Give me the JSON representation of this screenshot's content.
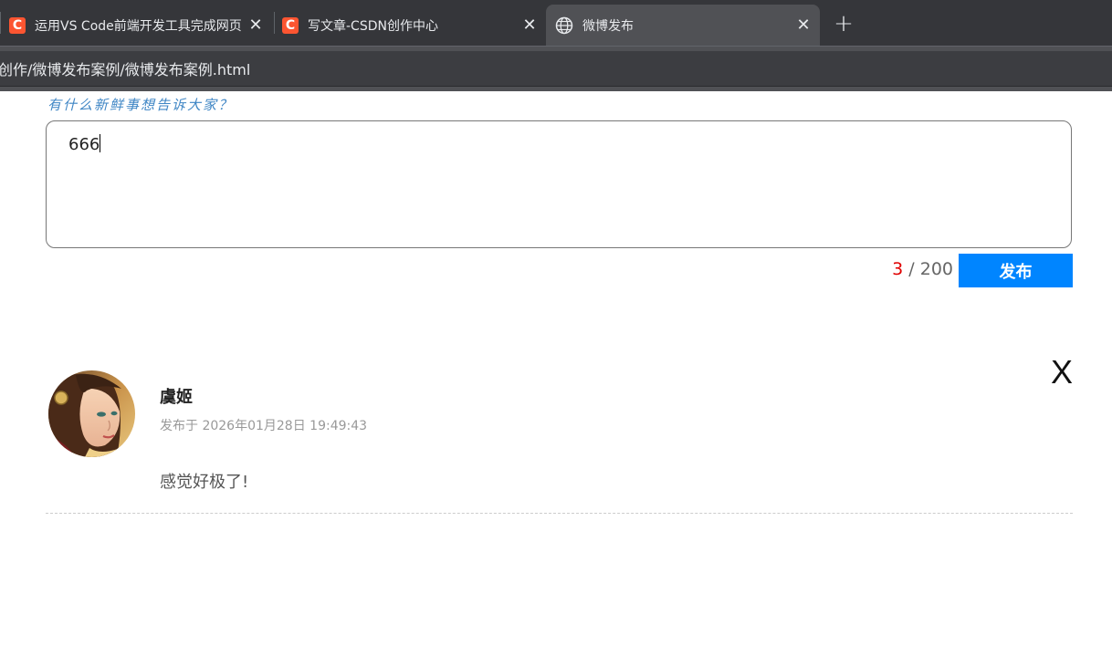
{
  "browser": {
    "tabs": [
      {
        "title": "运用VS Code前端开发工具完成网页",
        "icon": "csdn-icon",
        "active": false
      },
      {
        "title": "写文章-CSDN创作中心",
        "icon": "csdn-icon",
        "active": false
      },
      {
        "title": "微博发布",
        "icon": "globe-icon",
        "active": true
      }
    ],
    "favicon_letter": "C",
    "new_tab_symbol": "+",
    "close_symbol": "✕",
    "url": "创作/微博发布案例/微博发布案例.html"
  },
  "composer": {
    "prompt": "有什么新鲜事想告诉大家？",
    "text": "666",
    "count_current": "3",
    "count_separator": " / ",
    "count_max": "200",
    "publish_label": "发布"
  },
  "posts": [
    {
      "username": "虞姬",
      "timestamp": "发布于 2026年01月28日 19:49:43",
      "content": "感觉好极了!",
      "delete_label": "X"
    }
  ],
  "colors": {
    "accent": "#0085ff",
    "count_highlight": "#e00000",
    "csdn_brand": "#fc5531",
    "prompt_text": "#3f86c5"
  }
}
